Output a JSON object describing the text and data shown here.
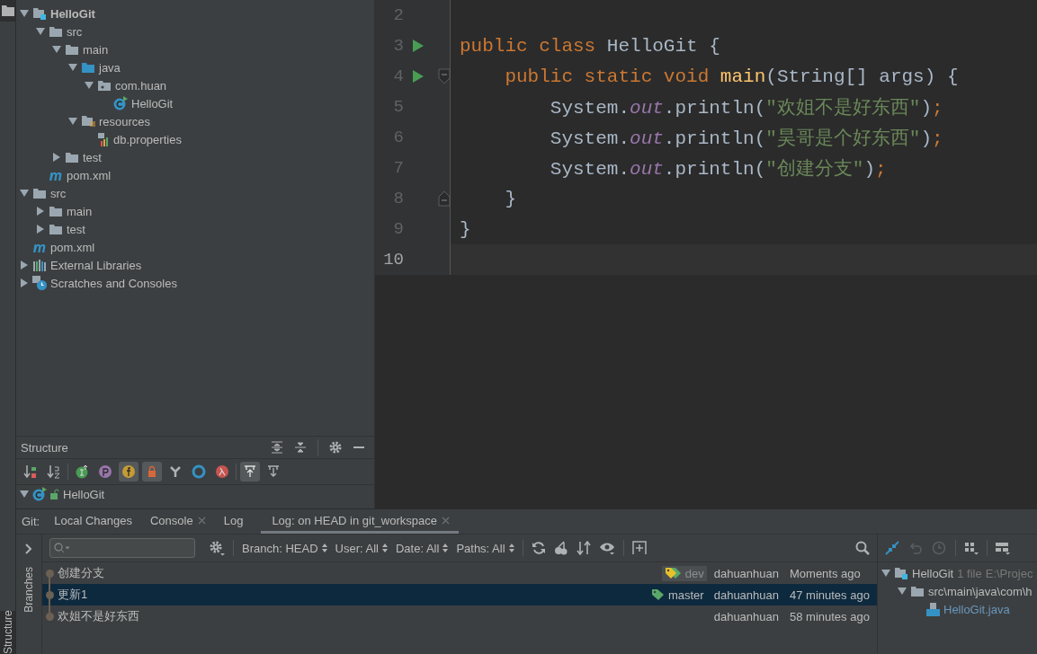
{
  "tool_strip": {
    "project_button": {
      "selected": true
    },
    "structure_tab": {
      "label": "Structure",
      "selected": true
    }
  },
  "project_tree": [
    {
      "children": [
        {
          "label": "HelloGit",
          "kind": "module",
          "bold": true,
          "expanded": true,
          "children": [
            {
              "label": "src",
              "kind": "folder",
              "expanded": true,
              "children": [
                {
                  "label": "main",
                  "kind": "folder",
                  "expanded": true,
                  "children": [
                    {
                      "label": "java",
                      "kind": "source-folder",
                      "expanded": true,
                      "children": [
                        {
                          "label": "com.huan",
                          "kind": "package",
                          "expanded": true,
                          "children": [
                            {
                              "label": "HelloGit",
                              "kind": "class"
                            }
                          ]
                        }
                      ]
                    },
                    {
                      "label": "resources",
                      "kind": "resources-folder",
                      "expanded": true,
                      "children": [
                        {
                          "label": "db.properties",
                          "kind": "properties"
                        }
                      ]
                    }
                  ]
                },
                {
                  "label": "test",
                  "kind": "folder",
                  "expanded": false
                }
              ]
            },
            {
              "label": "pom.xml",
              "kind": "maven"
            }
          ]
        },
        {
          "label": "src",
          "kind": "folder",
          "expanded": true,
          "children": [
            {
              "label": "main",
              "kind": "folder",
              "expanded": false
            },
            {
              "label": "test",
              "kind": "folder",
              "expanded": false
            }
          ]
        },
        {
          "label": "pom.xml",
          "kind": "maven"
        }
      ]
    },
    {
      "label": "External Libraries",
      "kind": "libraries",
      "expanded": false
    },
    {
      "label": "Scratches and Consoles",
      "kind": "scratches",
      "expanded": false
    }
  ],
  "structure": {
    "title": "Structure",
    "toolbar": [
      {
        "kind": "sort-visibility",
        "selected": false
      },
      {
        "kind": "sort-alpha",
        "selected": false
      },
      {
        "kind": "separator"
      },
      {
        "kind": "inherited",
        "selected": false
      },
      {
        "kind": "properties",
        "selected": false
      },
      {
        "kind": "fields",
        "selected": true
      },
      {
        "kind": "non-public",
        "selected": true
      },
      {
        "kind": "anonymous",
        "selected": false
      },
      {
        "kind": "interface",
        "selected": false
      },
      {
        "kind": "lambda",
        "selected": false
      },
      {
        "kind": "separator"
      },
      {
        "kind": "scroll-to-source",
        "selected": true
      },
      {
        "kind": "scroll-from-source",
        "selected": false
      }
    ],
    "tree": [
      {
        "label": "HelloGit",
        "expanded": true
      }
    ]
  },
  "editor": {
    "lines": [
      {
        "number": "2",
        "run": false,
        "kind": "plain",
        "current": false
      },
      {
        "number": "3",
        "run": true,
        "kind": "plain",
        "current": false,
        "tokens": [
          {
            "kind": "keyword",
            "text": "public class "
          },
          {
            "kind": "plain",
            "text": "HelloGit {"
          }
        ]
      },
      {
        "number": "4",
        "run": true,
        "kind": "fold-start",
        "current": false,
        "tokens": [
          {
            "kind": "keyword",
            "text": "    public static void "
          },
          {
            "kind": "method",
            "text": "main"
          },
          {
            "kind": "plain",
            "text": "(String[] args) {"
          }
        ]
      },
      {
        "number": "5",
        "run": false,
        "kind": "plain",
        "current": false,
        "tokens": [
          {
            "kind": "plain",
            "text": "        System."
          },
          {
            "kind": "field",
            "text": "out"
          },
          {
            "kind": "plain",
            "text": ".println("
          },
          {
            "kind": "string",
            "text": "\"欢姐不是好东西\""
          },
          {
            "kind": "plain",
            "text": ")"
          },
          {
            "kind": "keyword",
            "text": ";"
          }
        ]
      },
      {
        "number": "6",
        "run": false,
        "kind": "plain",
        "current": false,
        "tokens": [
          {
            "kind": "plain",
            "text": "        System."
          },
          {
            "kind": "field",
            "text": "out"
          },
          {
            "kind": "plain",
            "text": ".println("
          },
          {
            "kind": "string",
            "text": "\"昊哥是个好东西\""
          },
          {
            "kind": "plain",
            "text": ")"
          },
          {
            "kind": "keyword",
            "text": ";"
          }
        ]
      },
      {
        "number": "7",
        "run": false,
        "kind": "plain",
        "current": false,
        "tokens": [
          {
            "kind": "plain",
            "text": "        System."
          },
          {
            "kind": "field",
            "text": "out"
          },
          {
            "kind": "plain",
            "text": ".println("
          },
          {
            "kind": "string",
            "text": "\"创建分支\""
          },
          {
            "kind": "plain",
            "text": ")"
          },
          {
            "kind": "keyword",
            "text": ";"
          }
        ]
      },
      {
        "number": "8",
        "run": false,
        "kind": "fold-end",
        "current": false,
        "tokens": [
          {
            "kind": "plain",
            "text": "    }"
          }
        ]
      },
      {
        "number": "9",
        "run": false,
        "kind": "plain",
        "current": false,
        "tokens": [
          {
            "kind": "plain",
            "text": "}"
          }
        ]
      },
      {
        "number": "10",
        "run": false,
        "kind": "plain",
        "current": true
      }
    ]
  },
  "git": {
    "label": "Git:",
    "tabs": [
      {
        "label": "Local Changes",
        "closable": false,
        "selected": false
      },
      {
        "label": "Console",
        "closable": true,
        "selected": false
      },
      {
        "label": "Log",
        "closable": false,
        "selected": false
      },
      {
        "label": "Log: on HEAD in git_workspace",
        "closable": true,
        "selected": true
      }
    ],
    "branches_label": "Branches",
    "filters": [
      "Branch: HEAD",
      "User: All",
      "Date: All",
      "Paths: All"
    ],
    "commits": [
      {
        "message": "创建分支",
        "tag": {
          "label": "dev",
          "kind": "head"
        },
        "author": "dahuanhuan",
        "date": "Moments ago",
        "selected": false
      },
      {
        "message": "更新1",
        "tag": {
          "label": "master",
          "kind": "branch"
        },
        "author": "dahuanhuan",
        "date": "47 minutes ago",
        "selected": true
      },
      {
        "message": "欢姐不是好东西",
        "author": "dahuanhuan",
        "date": "58 minutes ago",
        "selected": false
      }
    ],
    "changes_toolbar": [
      {
        "kind": "collapse",
        "disabled": false
      },
      {
        "kind": "undo",
        "disabled": true
      },
      {
        "kind": "history",
        "disabled": true
      },
      {
        "kind": "separator"
      },
      {
        "kind": "group",
        "disabled": false
      },
      {
        "kind": "separator"
      },
      {
        "kind": "layout",
        "disabled": false
      }
    ],
    "changes": [
      {
        "label": "HelloGit",
        "count": "1 file",
        "path": "E:\\Projec",
        "kind": "module",
        "expanded": true,
        "children": [
          {
            "label": "src\\main\\java\\com\\h",
            "kind": "folder",
            "expanded": true,
            "children": [
              {
                "label": "HelloGit.java",
                "kind": "java-file",
                "modified": true
              }
            ]
          }
        ]
      }
    ]
  }
}
